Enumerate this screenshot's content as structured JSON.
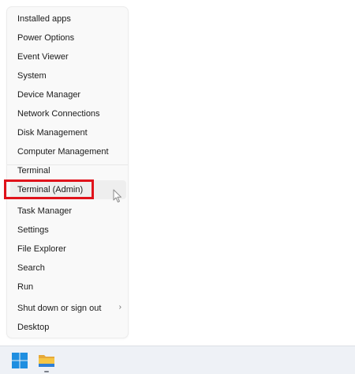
{
  "menu": {
    "items": [
      {
        "label": "Installed apps"
      },
      {
        "label": "Power Options"
      },
      {
        "label": "Event Viewer"
      },
      {
        "label": "System"
      },
      {
        "label": "Device Manager"
      },
      {
        "label": "Network Connections"
      },
      {
        "label": "Disk Management"
      },
      {
        "label": "Computer Management"
      },
      {
        "label": "Terminal"
      },
      {
        "label": "Terminal (Admin)"
      },
      {
        "label": "Task Manager"
      },
      {
        "label": "Settings"
      },
      {
        "label": "File Explorer"
      },
      {
        "label": "Search"
      },
      {
        "label": "Run"
      },
      {
        "label": "Shut down or sign out"
      },
      {
        "label": "Desktop"
      }
    ],
    "hovered_item": "Terminal (Admin)",
    "highlight_color": "#e0121b"
  },
  "taskbar": {
    "icons": [
      "windows-start-icon",
      "file-explorer-icon"
    ],
    "accent_color": "#1f8ee0"
  }
}
